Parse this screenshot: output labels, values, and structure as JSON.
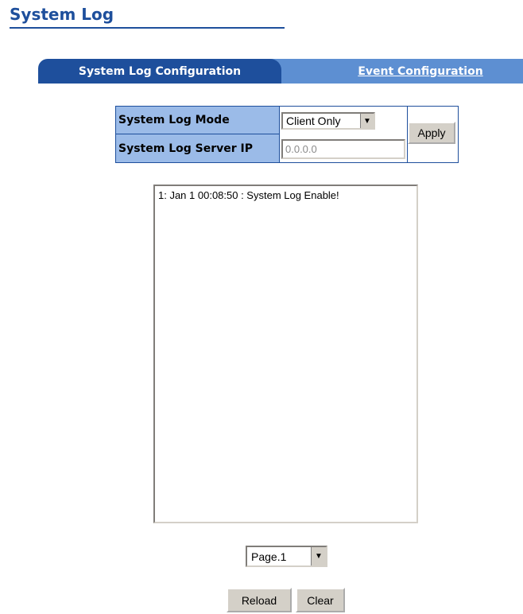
{
  "page": {
    "title": "System Log"
  },
  "tabs": [
    {
      "label": "System Log Configuration",
      "active": true
    },
    {
      "label": "Event Configuration",
      "active": false
    }
  ],
  "config": {
    "mode_label": "System Log Mode",
    "mode_value": "Client Only",
    "server_label": "System Log Server IP",
    "server_value": "0.0.0.0",
    "apply_label": "Apply"
  },
  "log": {
    "entries": [
      "1: Jan 1 00:08:50 : System Log Enable!"
    ]
  },
  "pagination": {
    "selected": "Page.1"
  },
  "actions": {
    "reload_label": "Reload",
    "clear_label": "Clear"
  },
  "colors": {
    "accent": "#1e4f9c",
    "tab_inactive": "#5d8fd2",
    "label_bg": "#9bbbe8"
  }
}
